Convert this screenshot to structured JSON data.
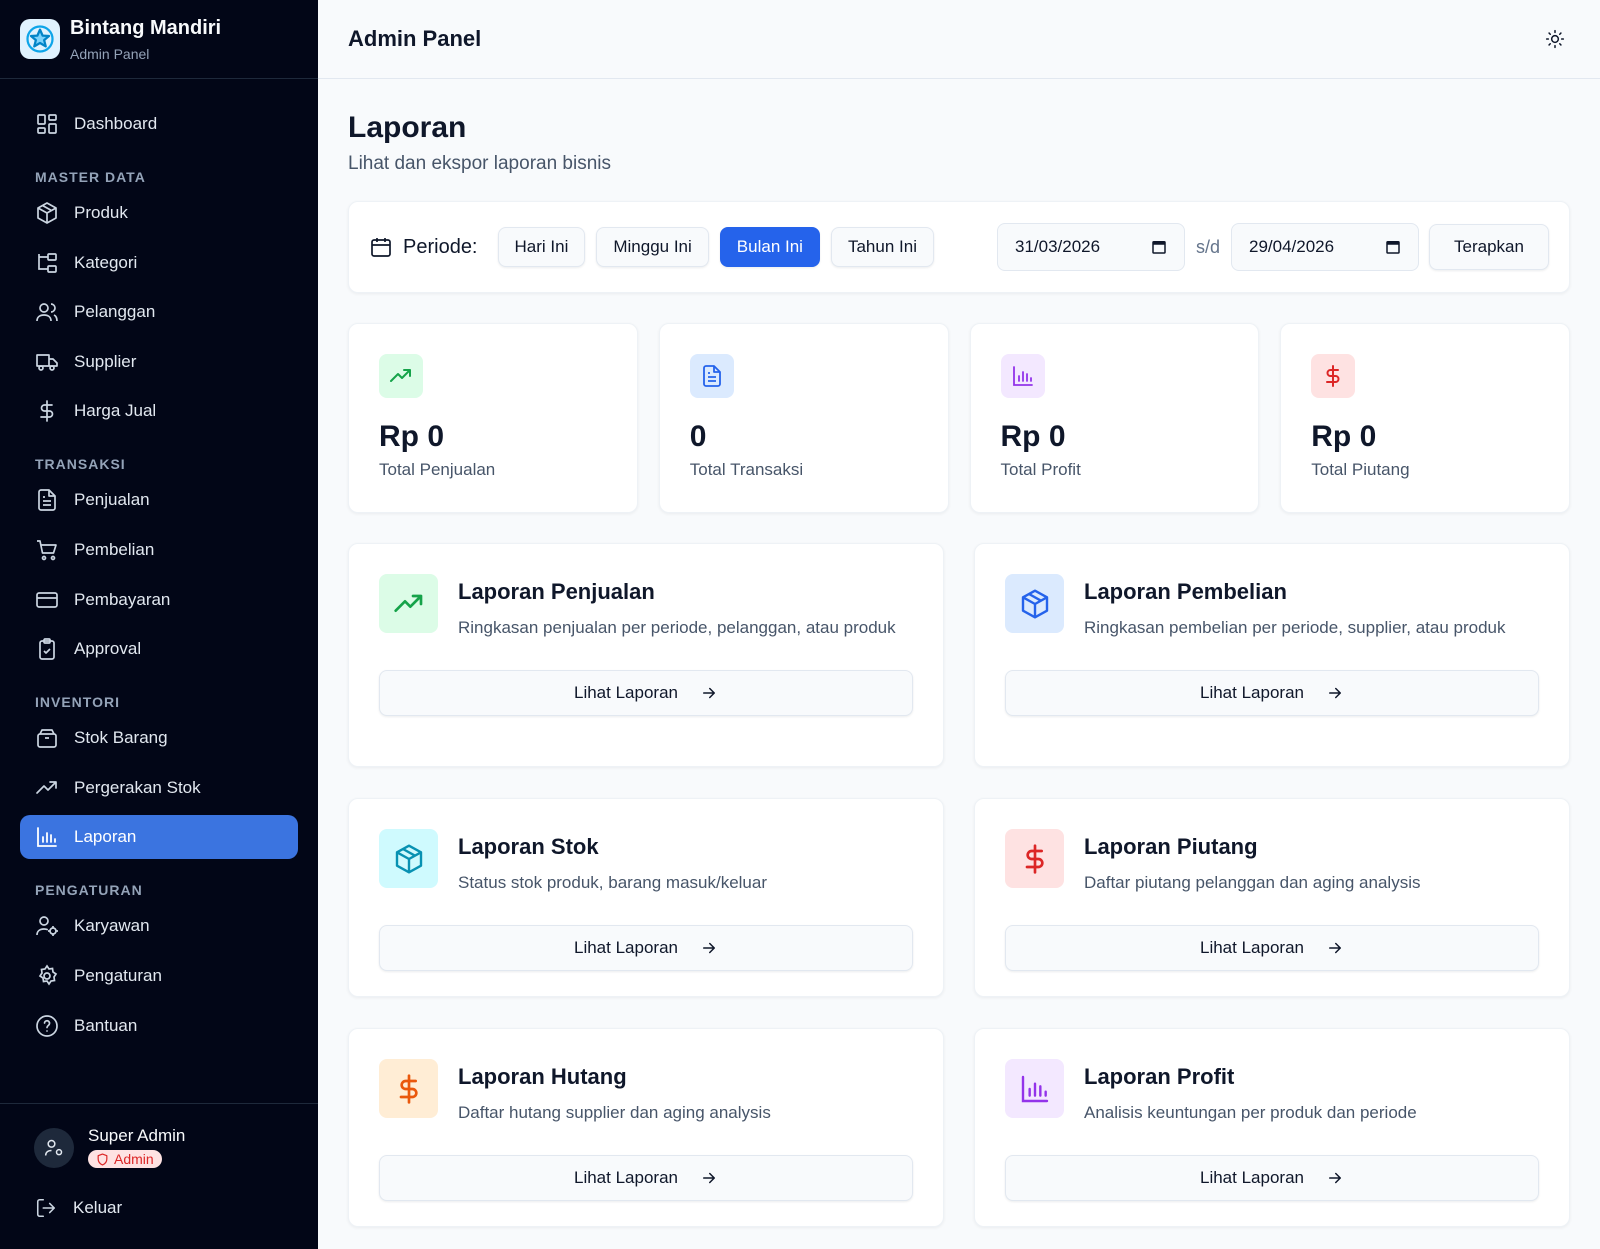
{
  "brand": {
    "name": "Bintang Mandiri",
    "subtitle": "Admin Panel"
  },
  "sidebar": {
    "dashboard": "Dashboard",
    "sections": {
      "master": "MASTER DATA",
      "transaksi": "TRANSAKSI",
      "inventori": "INVENTORI",
      "pengaturan": "PENGATURAN"
    },
    "items": {
      "produk": "Produk",
      "kategori": "Kategori",
      "pelanggan": "Pelanggan",
      "supplier": "Supplier",
      "harga": "Harga Jual",
      "penjualan": "Penjualan",
      "pembelian": "Pembelian",
      "pembayaran": "Pembayaran",
      "approval": "Approval",
      "stok": "Stok Barang",
      "pergerakan": "Pergerakan Stok",
      "laporan": "Laporan",
      "karyawan": "Karyawan",
      "pengaturan": "Pengaturan",
      "bantuan": "Bantuan"
    },
    "active": "laporan"
  },
  "user": {
    "name": "Super Admin",
    "role": "Admin",
    "logout": "Keluar"
  },
  "header": {
    "title": "Admin Panel",
    "theme_icon": "sun-icon"
  },
  "page": {
    "title": "Laporan",
    "subtitle": "Lihat dan ekspor laporan bisnis"
  },
  "filter": {
    "label": "Periode:",
    "options": [
      "Hari Ini",
      "Minggu Ini",
      "Bulan Ini",
      "Tahun Ini"
    ],
    "selected": "Bulan Ini",
    "start_date": "31/03/2026",
    "separator": "s/d",
    "end_date": "29/04/2026",
    "apply": "Terapkan"
  },
  "stats": [
    {
      "value": "Rp 0",
      "label": "Total Penjualan",
      "icon": "trending-up-icon",
      "color": "#16a34a",
      "bg": "#dcfce7"
    },
    {
      "value": "0",
      "label": "Total Transaksi",
      "icon": "file-text-icon",
      "color": "#2563eb",
      "bg": "#dbeafe"
    },
    {
      "value": "Rp 0",
      "label": "Total Profit",
      "icon": "bar-chart-icon",
      "color": "#9333ea",
      "bg": "#f3e8ff"
    },
    {
      "value": "Rp 0",
      "label": "Total Piutang",
      "icon": "dollar-icon",
      "color": "#dc2626",
      "bg": "#fee2e2"
    }
  ],
  "reports": [
    {
      "title": "Laporan Penjualan",
      "desc": "Ringkasan penjualan per periode, pelanggan, atau produk",
      "button": "Lihat Laporan",
      "icon": "trending-up-icon",
      "color": "#16a34a",
      "bg": "#dcfce7"
    },
    {
      "title": "Laporan Pembelian",
      "desc": "Ringkasan pembelian per periode, supplier, atau produk",
      "button": "Lihat Laporan",
      "icon": "package-icon",
      "color": "#2563eb",
      "bg": "#dbeafe"
    },
    {
      "title": "Laporan Stok",
      "desc": "Status stok produk, barang masuk/keluar",
      "button": "Lihat Laporan",
      "icon": "package-icon",
      "color": "#0891b2",
      "bg": "#cffafe"
    },
    {
      "title": "Laporan Piutang",
      "desc": "Daftar piutang pelanggan dan aging analysis",
      "button": "Lihat Laporan",
      "icon": "dollar-icon",
      "color": "#dc2626",
      "bg": "#fee2e2"
    },
    {
      "title": "Laporan Hutang",
      "desc": "Daftar hutang supplier dan aging analysis",
      "button": "Lihat Laporan",
      "icon": "dollar-icon",
      "color": "#ea580c",
      "bg": "#ffedd5"
    },
    {
      "title": "Laporan Profit",
      "desc": "Analisis keuntungan per produk dan periode",
      "button": "Lihat Laporan",
      "icon": "bar-chart-icon",
      "color": "#9333ea",
      "bg": "#f3e8ff"
    }
  ]
}
